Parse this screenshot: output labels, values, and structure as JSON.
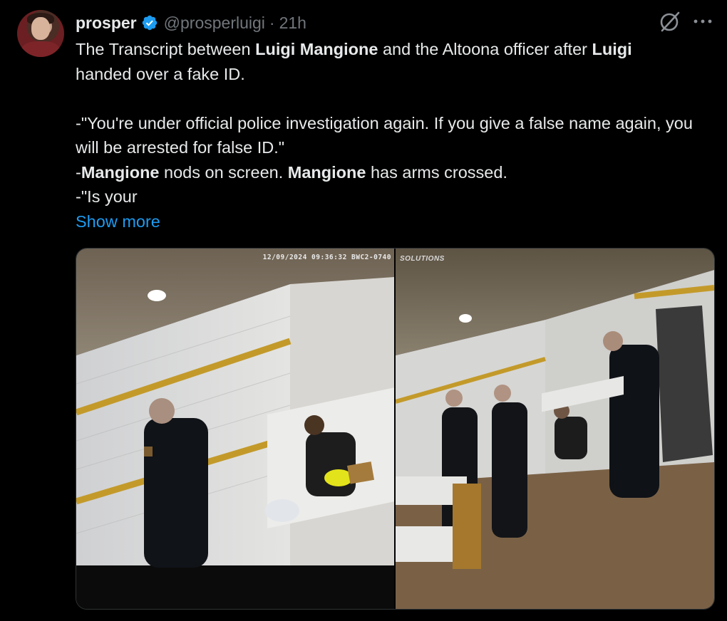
{
  "author": {
    "name": "prosper",
    "handle": "@prosperluigi",
    "separator": "·",
    "time": "21h",
    "verified": true
  },
  "tweet": {
    "line1_pre": "The Transcript between ",
    "line1_bold1": "Luigi Mangione",
    "line1_mid": " and the Altoona officer after ",
    "line1_bold2": "Luigi",
    "line2": "handed over a fake ID.",
    "quote1": "-\"You're under official police investigation again. If you give a false name again, you will be arrested for false ID.\"",
    "line_dash": "-",
    "bold_mangione_1": "Mangione",
    "nods": " nods on screen. ",
    "bold_mangione_2": "Mangione",
    "arms": " has arms crossed.",
    "quote2": "-\"Is your",
    "show_more": "Show more"
  },
  "media": {
    "timestamp": "12/09/2024 09:36:32 BWC2-0740",
    "watermark": "SOLUTIONS"
  },
  "icons": {
    "verified": "verified-badge-icon",
    "grok": "grok-icon",
    "more": "more-options-icon"
  },
  "colors": {
    "background": "#000000",
    "text": "#e7e9ea",
    "secondary": "#71767b",
    "link": "#1d9bf0",
    "verified": "#1d9bf0"
  }
}
